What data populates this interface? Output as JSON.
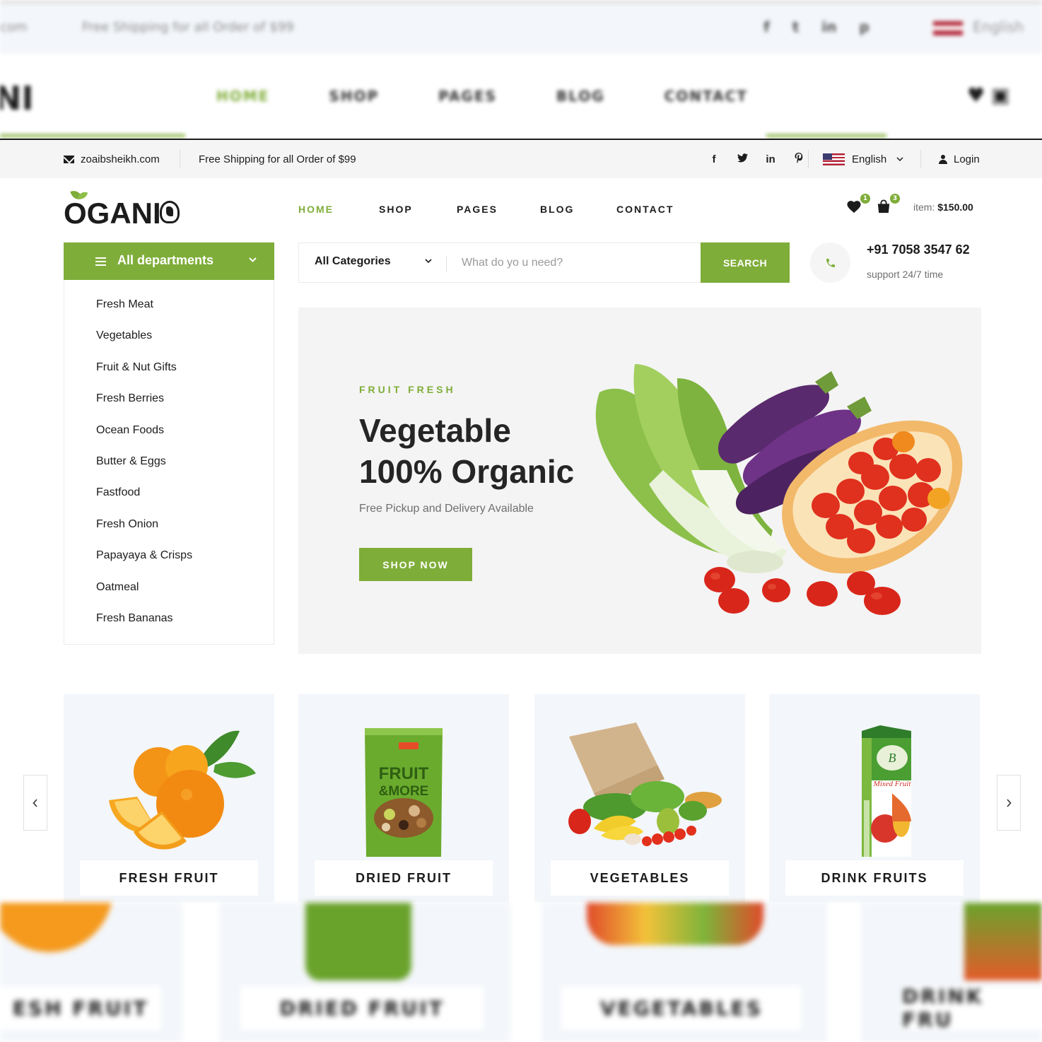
{
  "topbar": {
    "email": "zoaibsheikh.com",
    "shipping": "Free Shipping for all Order of $99",
    "social": [
      "f",
      "t",
      "in",
      "p"
    ],
    "language": "English",
    "login": "Login"
  },
  "blurred_header": {
    "email": "com",
    "shipping": "Free Shipping for all Order of $99",
    "language": "English",
    "logo": "NI",
    "nav": [
      "HOME",
      "SHOP",
      "PAGES",
      "BLOG",
      "CONTACT"
    ]
  },
  "logo": {
    "text": "OGANI"
  },
  "nav": [
    "HOME",
    "SHOP",
    "PAGES",
    "BLOG",
    "CONTACT"
  ],
  "cart": {
    "wishlist_count": "1",
    "cart_count": "3",
    "price_label": "item:",
    "price_value": "$150.00"
  },
  "departments": {
    "title": "All departments",
    "items": [
      "Fresh Meat",
      "Vegetables",
      "Fruit & Nut Gifts",
      "Fresh Berries",
      "Ocean Foods",
      "Butter & Eggs",
      "Fastfood",
      "Fresh Onion",
      "Papayaya & Crisps",
      "Oatmeal",
      "Fresh Bananas"
    ]
  },
  "search": {
    "category": "All Categories",
    "placeholder": "What do yo u need?",
    "button": "SEARCH"
  },
  "contact": {
    "phone": "+91 7058 3547 62",
    "support": "support 24/7 time"
  },
  "hero": {
    "kicker": "FRUIT FRESH",
    "title_line1": "Vegetable",
    "title_line2": "100% Organic",
    "subtitle": "Free Pickup and Delivery Available",
    "button": "SHOP NOW"
  },
  "categories": [
    "FRESH FRUIT",
    "DRIED FRUIT",
    "VEGETABLES",
    "DRINK FRUITS"
  ],
  "blurred_categories": [
    "ESH FRUIT",
    "DRIED FRUIT",
    "VEGETABLES",
    "DRINK FRU"
  ],
  "colors": {
    "accent": "#7fad39",
    "dark": "#1c1c1c",
    "light_bg": "#f3f6fa"
  },
  "icons": [
    "mail-icon",
    "facebook-icon",
    "twitter-icon",
    "linkedin-icon",
    "pinterest-icon",
    "flag-icon",
    "user-icon",
    "heart-icon",
    "bag-icon",
    "menu-icon",
    "chevron-down-icon",
    "phone-icon",
    "chevron-left-icon",
    "chevron-right-icon"
  ]
}
